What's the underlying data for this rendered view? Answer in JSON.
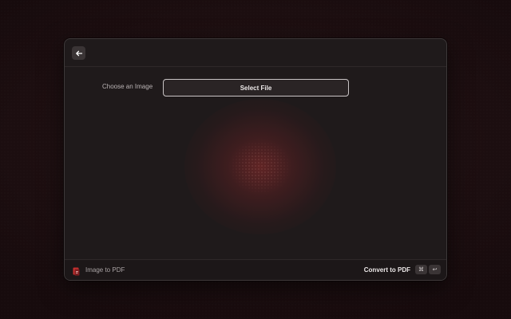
{
  "window": {
    "back_icon": "arrow-left-icon"
  },
  "form": {
    "choose_label": "Choose an Image",
    "select_button_label": "Select File"
  },
  "footer": {
    "app_icon": "pdf-app-icon",
    "app_name": "Image to PDF",
    "action_label": "Convert to PDF",
    "shortcut_modifier": "⌘",
    "shortcut_key": "↩"
  },
  "colors": {
    "accent_glow": "#962d2d",
    "window_bg": "#1f1a1b",
    "button_border": "#c9c4c5"
  }
}
